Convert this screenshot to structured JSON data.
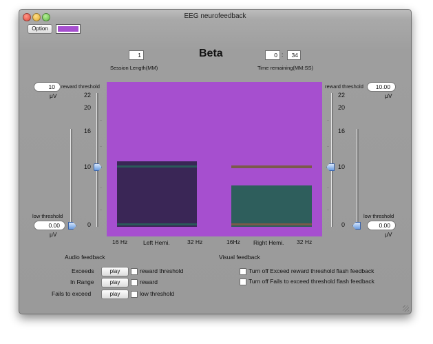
{
  "window": {
    "title": "EEG neurofeedback"
  },
  "toolbar": {
    "option_label": "Option",
    "color_swatch": "#a64fcf"
  },
  "session": {
    "length_value": "1",
    "length_label": "Session Length(MM)",
    "band_title": "Beta",
    "remaining_minutes": "0",
    "remaining_separator": ":",
    "remaining_seconds": "34",
    "remaining_label": "Time remaining(MM:SS)"
  },
  "left_panel": {
    "reward_value": "10",
    "reward_label": "reward threshold",
    "reward_unit": "μV",
    "low_label": "low threshold",
    "low_value": "0.00",
    "low_unit": "μV",
    "ticks": [
      "22",
      "20",
      "16",
      "10",
      "0"
    ]
  },
  "right_panel": {
    "reward_label": "reward threshold",
    "reward_value": "10.00",
    "reward_unit": "μV",
    "low_label": "low threshold",
    "low_value": "0.00",
    "low_unit": "μV",
    "ticks": [
      "22",
      "20",
      "16",
      "10",
      "0"
    ]
  },
  "display": {
    "background": "#a64fcf",
    "left_bar_color": "#3a2656",
    "left_line_color": "#2a5a5a",
    "right_bar_color": "#2e5e5c",
    "right_line_color": "#7a5a4a"
  },
  "axis": {
    "left_start": "16 Hz",
    "left_name": "Left Hemi.",
    "left_end": "32 Hz",
    "right_start": "16Hz",
    "right_name": "Right Hemi.",
    "right_end": "32 Hz"
  },
  "audio": {
    "title": "Audio feedback",
    "rows": [
      {
        "label": "Exceeds",
        "button": "play",
        "check_label": "reward threshold"
      },
      {
        "label": "In Range",
        "button": "play",
        "check_label": "reward"
      },
      {
        "label": "Fails to exceed",
        "button": "play",
        "check_label": "low threshold"
      }
    ]
  },
  "visual": {
    "title": "Visual feedback",
    "options": [
      "Turn off Exceed reward threshold flash feedback",
      "Turn off Fails to exceed threshold flash feedback"
    ]
  }
}
